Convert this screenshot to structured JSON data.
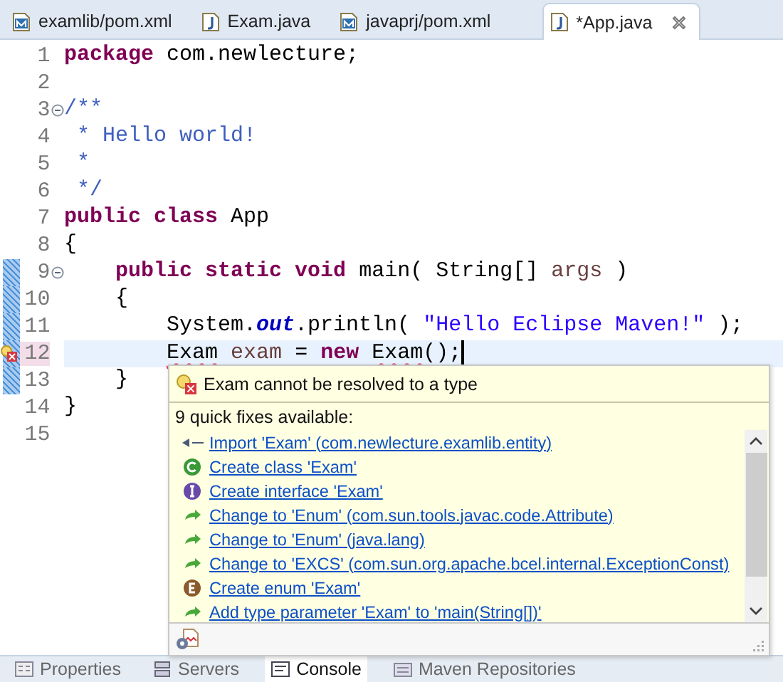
{
  "tabs": [
    {
      "label": "examlib/pom.xml",
      "kind": "xml",
      "selected": false,
      "closable": false
    },
    {
      "label": "Exam.java",
      "kind": "java",
      "selected": false,
      "closable": false
    },
    {
      "label": "javaprj/pom.xml",
      "kind": "xml",
      "selected": false,
      "closable": false
    },
    {
      "label": "*App.java",
      "kind": "java",
      "selected": true,
      "closable": true
    }
  ],
  "editor": {
    "lines": [
      {
        "number": "1",
        "changed": false,
        "fold": false,
        "error": false,
        "current": false,
        "tokens": [
          {
            "text": "package",
            "kind": "keyword"
          },
          {
            "text": " com.newlecture;",
            "kind": "plain"
          }
        ]
      },
      {
        "number": "2",
        "changed": false,
        "fold": false,
        "error": false,
        "current": false
      },
      {
        "number": "3",
        "changed": false,
        "fold": true,
        "error": false,
        "current": false,
        "tokens": [
          {
            "text": "/**",
            "kind": "comment"
          }
        ]
      },
      {
        "number": "4",
        "changed": false,
        "fold": false,
        "error": false,
        "current": false,
        "tokens": [
          {
            "text": " * Hello world!",
            "kind": "comment"
          }
        ]
      },
      {
        "number": "5",
        "changed": false,
        "fold": false,
        "error": false,
        "current": false,
        "tokens": [
          {
            "text": " *",
            "kind": "comment"
          }
        ]
      },
      {
        "number": "6",
        "changed": false,
        "fold": false,
        "error": false,
        "current": false,
        "tokens": [
          {
            "text": " */",
            "kind": "comment"
          }
        ]
      },
      {
        "number": "7",
        "changed": false,
        "fold": false,
        "error": false,
        "current": false,
        "tokens": [
          {
            "text": "public class",
            "kind": "keyword"
          },
          {
            "text": " App",
            "kind": "plain"
          }
        ]
      },
      {
        "number": "8",
        "changed": false,
        "fold": false,
        "error": false,
        "current": false,
        "tokens": [
          {
            "text": "{",
            "kind": "plain"
          }
        ]
      },
      {
        "number": "9",
        "changed": true,
        "fold": true,
        "error": false,
        "current": false,
        "tokens": [
          {
            "text": "    public static void",
            "kind": "keyword"
          },
          {
            "text": " main( String[] ",
            "kind": "plain"
          },
          {
            "text": "args",
            "kind": "local"
          },
          {
            "text": " )",
            "kind": "plain"
          }
        ]
      },
      {
        "number": "10",
        "changed": true,
        "fold": false,
        "error": false,
        "current": false,
        "tokens": [
          {
            "text": "    {",
            "kind": "plain"
          }
        ]
      },
      {
        "number": "11",
        "changed": true,
        "fold": false,
        "error": false,
        "current": false,
        "tokens": [
          {
            "text": "        System.",
            "kind": "plain"
          },
          {
            "text": "out",
            "kind": "static_field"
          },
          {
            "text": ".println( ",
            "kind": "plain"
          },
          {
            "text": "\"Hello Eclipse Maven!\"",
            "kind": "string"
          },
          {
            "text": " );",
            "kind": "plain"
          }
        ]
      },
      {
        "number": "12",
        "changed": true,
        "fold": false,
        "error": true,
        "current": true,
        "tokens": [
          {
            "text": "        Exam",
            "kind": "error"
          },
          {
            "text": " exam",
            "kind": "local"
          },
          {
            "text": " = ",
            "kind": "plain"
          },
          {
            "text": "new",
            "kind": "keyword"
          },
          {
            "text": " Exam",
            "kind": "error"
          },
          {
            "text": "();",
            "kind": "plain"
          }
        ]
      },
      {
        "number": "13",
        "changed": true,
        "fold": false,
        "error": false,
        "current": false,
        "tokens": [
          {
            "text": "    }",
            "kind": "plain"
          }
        ]
      },
      {
        "number": "14",
        "changed": false,
        "fold": false,
        "error": false,
        "current": false,
        "tokens": [
          {
            "text": "}",
            "kind": "plain"
          }
        ]
      },
      {
        "number": "15",
        "changed": false,
        "fold": false,
        "error": false,
        "current": false
      }
    ]
  },
  "quick_fix": {
    "problem": "Exam cannot be resolved to a type",
    "summary": "9 quick fixes available:",
    "fixes": [
      {
        "label": "Import 'Exam' (com.newlecture.examlib.entity)",
        "kind": "import"
      },
      {
        "label": "Create class 'Exam'",
        "kind": "class"
      },
      {
        "label": "Create interface 'Exam'",
        "kind": "interface"
      },
      {
        "label": "Change to 'Enum' (com.sun.tools.javac.code.Attribute)",
        "kind": "change"
      },
      {
        "label": "Change to 'Enum' (java.lang)",
        "kind": "change"
      },
      {
        "label": "Change to 'EXCS' (com.sun.org.apache.bcel.internal.ExceptionConst)",
        "kind": "change"
      },
      {
        "label": "Create enum 'Exam'",
        "kind": "enum"
      },
      {
        "label": "Add type parameter 'Exam' to 'main(String[])'",
        "kind": "change"
      }
    ]
  },
  "bottom_tabs": [
    {
      "label": "Properties",
      "kind": "properties",
      "selected": false
    },
    {
      "label": "Servers",
      "kind": "servers",
      "selected": false
    },
    {
      "label": "Console",
      "kind": "console",
      "selected": true
    },
    {
      "label": "Maven Repositories",
      "kind": "repos",
      "selected": false
    }
  ]
}
